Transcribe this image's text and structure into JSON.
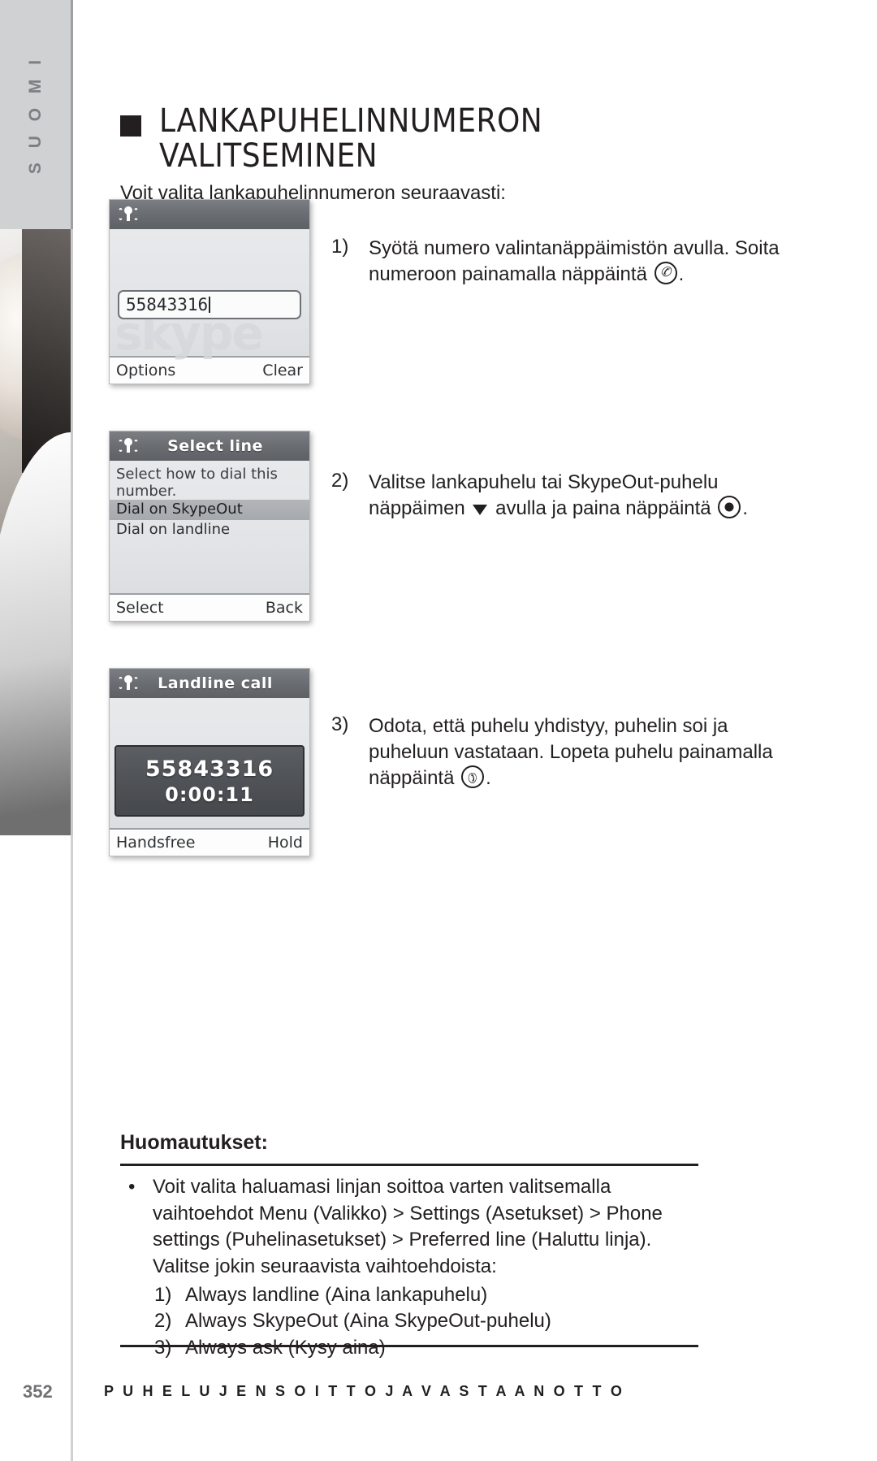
{
  "sidebar": {
    "language_tab": "S U O M I"
  },
  "heading": {
    "line1": "LANKAPUHELINNUMERON",
    "line2": "VALITSEMINEN"
  },
  "intro": "Voit valita lankapuhelinnumeron seuraavasti:",
  "screens": [
    {
      "title": "",
      "status_icon": "signal-icon",
      "number_value": "55843316",
      "watermark": "skype",
      "softkey_left": "Options",
      "softkey_right": "Clear"
    },
    {
      "title": "Select line",
      "status_icon": "signal-icon",
      "description": "Select how to dial this number.",
      "items": [
        {
          "label": "Dial on SkypeOut",
          "selected": true
        },
        {
          "label": "Dial on landline",
          "selected": false
        }
      ],
      "softkey_left": "Select",
      "softkey_right": "Back"
    },
    {
      "title": "Landline call",
      "status_icon": "signal-icon",
      "call_number": "55843316",
      "call_timer": "0:00:11",
      "softkey_left": "Handsfree",
      "softkey_right": "Hold"
    }
  ],
  "steps": [
    {
      "num": "1)",
      "part1": "Syötä numero valintanäppäimistön avulla. Soita numeroon painamalla näppäintä ",
      "icon": "call-key-icon",
      "part2": "."
    },
    {
      "num": "2)",
      "part1": "Valitse lankapuhelu tai SkypeOut-puhelu näppäimen ",
      "icon": "arrow-down-icon",
      "part2": " avulla ja paina näppäintä ",
      "icon2": "ok-key-icon",
      "part3": "."
    },
    {
      "num": "3)",
      "part1": "Odota, että puhelu yhdistyy, puhelin soi ja puheluun vastataan. Lopeta puhelu painamalla näppäintä ",
      "icon": "end-call-key-icon",
      "part2": "."
    }
  ],
  "notes": {
    "title": "Huomautukset:",
    "bullet": "•",
    "items": [
      "Voit valita haluamasi linjan soittoa varten valitsemalla vaihtoehdot Menu (Valikko) > Settings (Asetukset) > Phone settings (Puhelinasetukset) > Preferred line (Haluttu linja). Valitse jokin seuraavista vaihtoehdoista:"
    ],
    "sub_items": [
      {
        "num": "1)",
        "label": "Always landline (Aina lankapuhelu)"
      },
      {
        "num": "2)",
        "label": "Always SkypeOut (Aina SkypeOut-puhelu)"
      },
      {
        "num": "3)",
        "label": "Always ask (Kysy aina)"
      }
    ]
  },
  "footer": {
    "page_number": "352",
    "section": "P U H E L U J E N  S O I T T O  J A  V A S T A A N O T T O"
  },
  "colors": {
    "ink": "#231f20",
    "sidebar_tab": "#cfd1d3",
    "sidebar_label": "#7d7f82",
    "screen_titlebar": "#6b6e73",
    "screen_body": "#e3e5e8",
    "call_box": "#4e5155"
  }
}
